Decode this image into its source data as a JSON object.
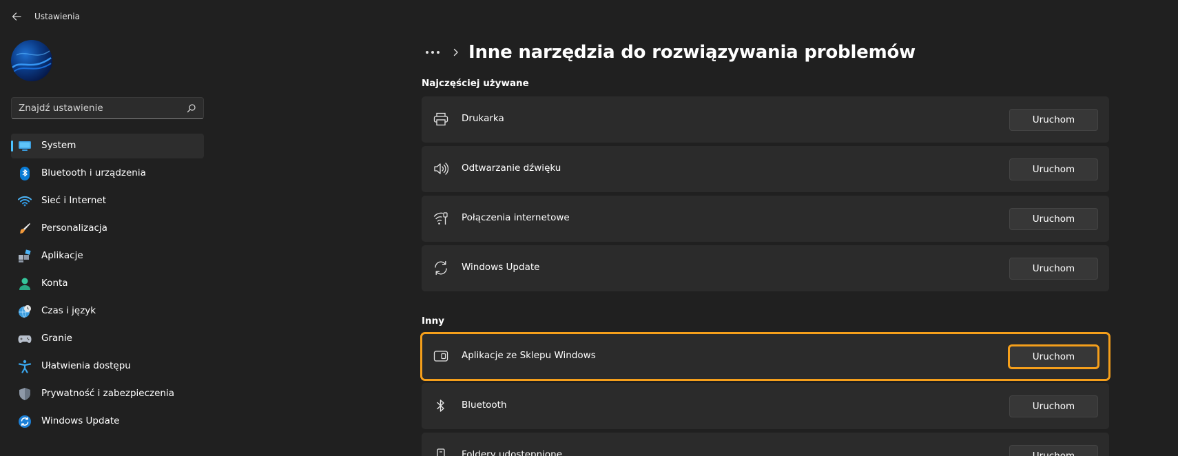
{
  "window": {
    "title": "Ustawienia"
  },
  "search": {
    "placeholder": "Znajdź ustawienie"
  },
  "sidebar": {
    "items": [
      {
        "label": "System",
        "icon": "monitor-icon",
        "active": true
      },
      {
        "label": "Bluetooth i urządzenia",
        "icon": "bluetooth-icon"
      },
      {
        "label": "Sieć i Internet",
        "icon": "wifi-icon"
      },
      {
        "label": "Personalizacja",
        "icon": "brush-icon"
      },
      {
        "label": "Aplikacje",
        "icon": "apps-icon"
      },
      {
        "label": "Konta",
        "icon": "person-icon"
      },
      {
        "label": "Czas i język",
        "icon": "globe-clock-icon"
      },
      {
        "label": "Granie",
        "icon": "gamepad-icon"
      },
      {
        "label": "Ułatwienia dostępu",
        "icon": "accessibility-icon"
      },
      {
        "label": "Prywatność i zabezpieczenia",
        "icon": "shield-icon"
      },
      {
        "label": "Windows Update",
        "icon": "update-icon"
      }
    ]
  },
  "breadcrumb": {
    "title": "Inne narzędzia do rozwiązywania problemów"
  },
  "sections": {
    "frequent": {
      "title": "Najczęściej używane",
      "items": [
        {
          "label": "Drukarka",
          "button": "Uruchom",
          "icon": "printer-icon"
        },
        {
          "label": "Odtwarzanie dźwięku",
          "button": "Uruchom",
          "icon": "speaker-icon"
        },
        {
          "label": "Połączenia internetowe",
          "button": "Uruchom",
          "icon": "network-icon"
        },
        {
          "label": "Windows Update",
          "button": "Uruchom",
          "icon": "sync-icon"
        }
      ]
    },
    "other": {
      "title": "Inny",
      "items": [
        {
          "label": "Aplikacje ze Sklepu Windows",
          "button": "Uruchom",
          "icon": "store-app-icon"
        },
        {
          "label": "Bluetooth",
          "button": "Uruchom",
          "icon": "bluetooth-icon"
        },
        {
          "label": "Foldery udostępnione",
          "button": "Uruchom",
          "icon": "shared-folder-icon"
        }
      ]
    }
  },
  "colors": {
    "accent": "#4cc2ff",
    "highlight": "#f59f1b",
    "background": "#202020",
    "card": "#2b2b2b"
  }
}
